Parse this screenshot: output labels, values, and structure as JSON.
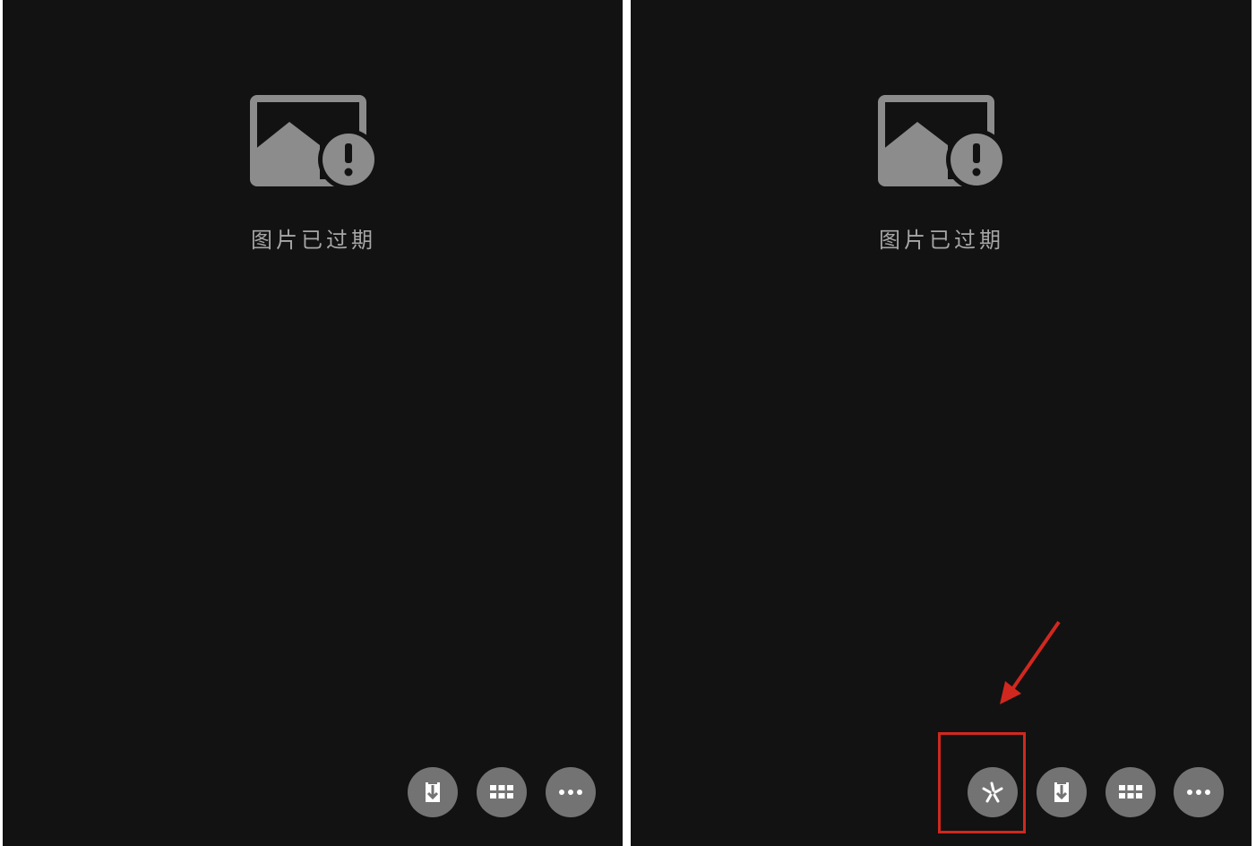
{
  "panels": [
    {
      "id": "left",
      "status_text": "图片已过期",
      "toolbar": [
        {
          "icon": "download-icon"
        },
        {
          "icon": "grid-icon"
        },
        {
          "icon": "more-icon"
        }
      ]
    },
    {
      "id": "right",
      "status_text": "图片已过期",
      "toolbar": [
        {
          "icon": "sparkle-icon"
        },
        {
          "icon": "download-icon"
        },
        {
          "icon": "grid-icon"
        },
        {
          "icon": "more-icon"
        }
      ],
      "annotation": {
        "highlight_color": "#d0281f"
      }
    }
  ],
  "colors": {
    "panel_bg": "#121212",
    "icon_gray": "#8c8c8c",
    "text_gray": "#a6a6a6",
    "button_bg": "#737373",
    "annotation_red": "#d0281f"
  }
}
